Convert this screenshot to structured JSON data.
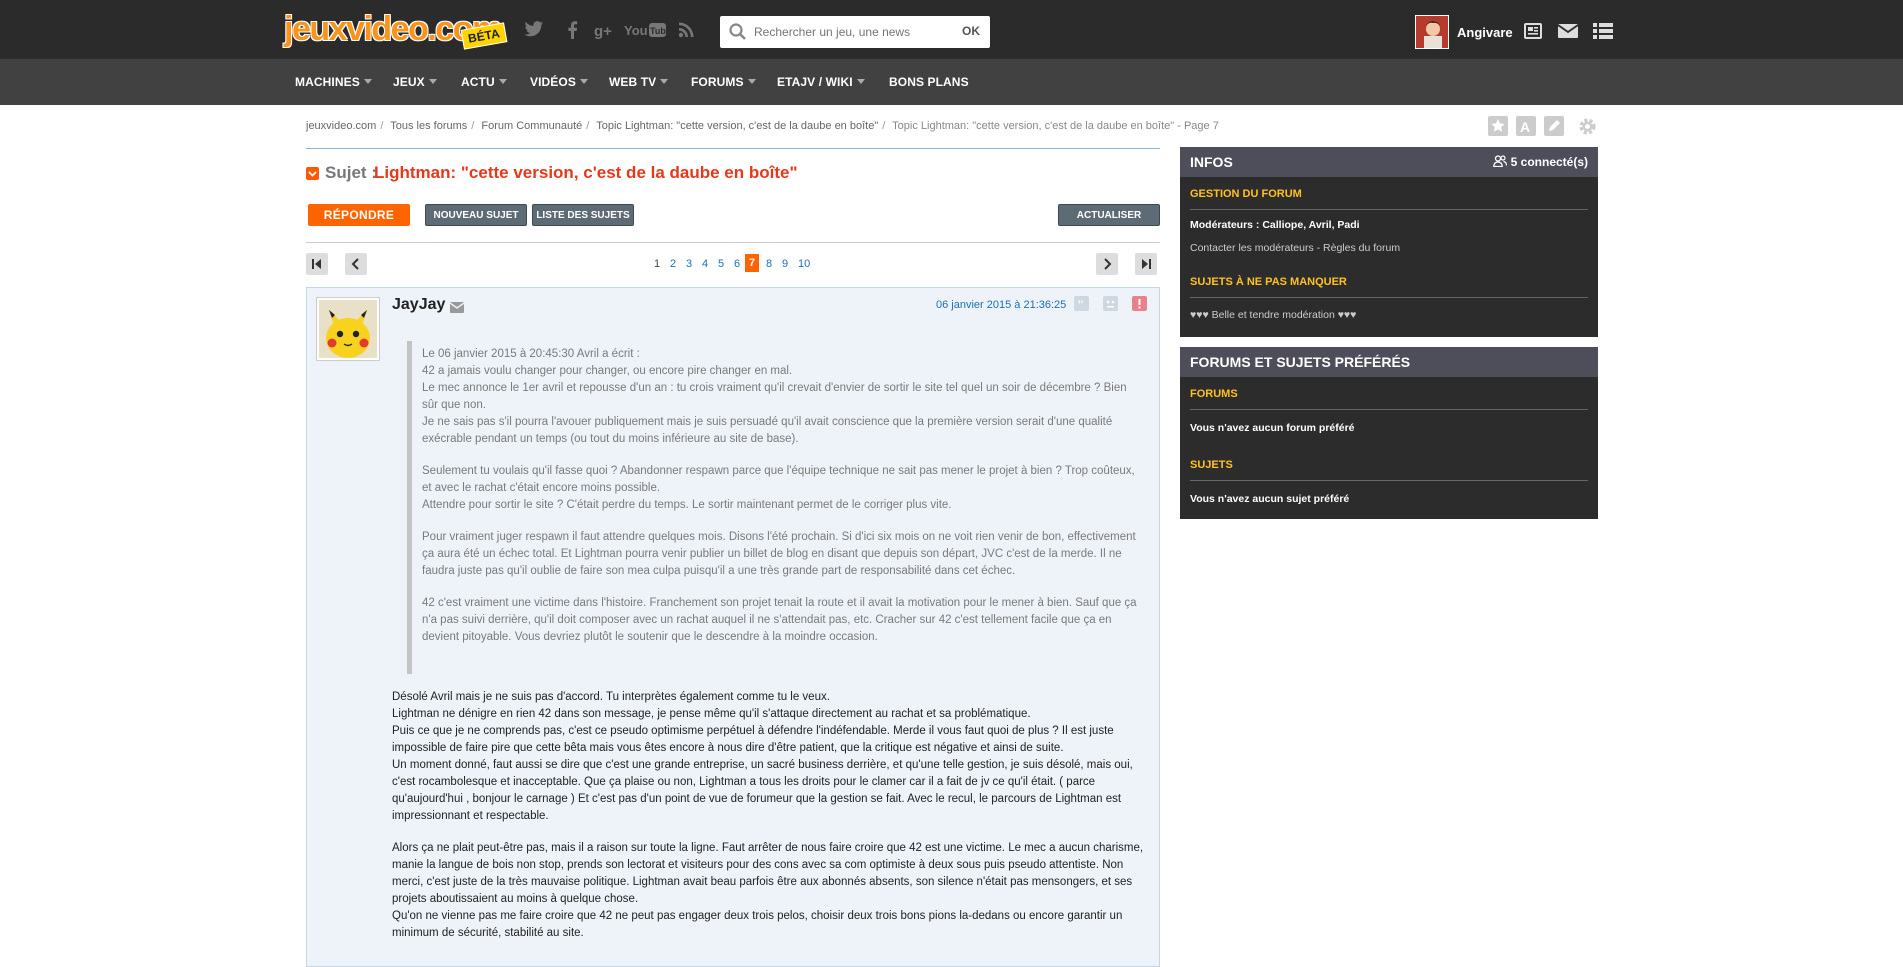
{
  "logo": {
    "text": "jeuxvideo.com",
    "badge": "BÉTA"
  },
  "search": {
    "placeholder": "Rechercher un jeu, une news",
    "ok": "OK"
  },
  "user": {
    "name": "Angivare"
  },
  "nav": [
    "MACHINES",
    "JEUX",
    "ACTU",
    "VIDÉOS",
    "WEB TV",
    "FORUMS",
    "ETAJV / WIKI",
    "BONS PLANS"
  ],
  "breadcrumb": [
    "jeuxvideo.com",
    "Tous les forums",
    "Forum Communauté",
    "Topic Lightman: \"cette version, c'est de la daube en boîte\"",
    "Topic Lightman: \"cette version, c'est de la daube en boîte\" - Page 7"
  ],
  "subject": {
    "label": "Sujet :",
    "title": "Lightman: \"cette version, c'est de la daube en boîte\""
  },
  "buttons": {
    "reply": "RÉPONDRE",
    "new_topic": "NOUVEAU SUJET",
    "topic_list": "LISTE DES SUJETS",
    "refresh": "ACTUALISER"
  },
  "pagination": {
    "pages": [
      "1",
      "2",
      "3",
      "4",
      "5",
      "6",
      "7",
      "8",
      "9",
      "10"
    ],
    "current": "7"
  },
  "post": {
    "author": "JayJay",
    "date": "06 janvier 2015 à 21:36:25",
    "quote": [
      "Le 06 janvier 2015 à 20:45:30 Avril a écrit :",
      "42 a jamais voulu changer pour changer, ou encore pire changer en mal.",
      "Le mec annonce le 1er avril et repousse d'un an : tu crois vraiment qu'il crevait d'envier de sortir le site tel quel un soir de décembre ? Bien sûr que non.",
      "Je ne sais pas s'il pourra l'avouer publiquement mais je suis persuadé qu'il avait conscience que la première version serait d'une qualité exécrable pendant un temps (ou tout du moins inférieure au site de base).",
      "Seulement tu voulais qu'il fasse quoi ? Abandonner respawn parce que l'équipe technique ne sait pas mener le projet à bien ? Trop coûteux, et avec le rachat c'était encore moins possible.",
      "Attendre pour sortir le site ? C'était perdre du temps. Le sortir maintenant permet de le corriger plus vite.",
      "Pour vraiment juger respawn il faut attendre quelques mois. Disons l'été prochain. Si d'ici six mois on ne voit rien venir de bon, effectivement ça aura été un échec total. Et Lightman pourra venir publier un billet de blog en disant que depuis son départ, JVC c'est de la merde. Il ne faudra juste pas qu'il oublie de faire son mea culpa puisqu'il a une très grande part de responsabilité dans cet échec.",
      "42 c'est vraiment une victime dans l'histoire. Franchement son projet tenait la route et il avait la motivation pour le mener à bien. Sauf que ça n'a pas suivi derrière, qu'il doit composer avec un rachat auquel il ne s'attendait pas, etc. Cracher sur 42 c'est tellement facile que ça en devient pitoyable. Vous devriez plutôt le soutenir que le descendre à la moindre occasion."
    ],
    "body": [
      "Désolé Avril mais je ne suis pas d'accord. Tu interprètes également comme tu le veux.",
      "Lightman ne dénigre en rien 42 dans son message, je pense même qu'il s'attaque directement au rachat et sa problématique.",
      "Puis ce que je ne comprends pas, c'est ce pseudo optimisme perpétuel à défendre l'indéfendable. Merde il vous faut quoi de plus ? Il est juste impossible de faire pire que cette bêta mais vous êtes encore à nous dire d'être patient, que la critique est négative et ainsi de suite.",
      "Un moment donné, faut aussi se dire que c'est une grande entreprise, un sacré business derrière, et qu'une telle gestion, je suis désolé, mais oui, c'est rocambolesque et inacceptable. Que ça plaise ou non, Lightman a tous les droits pour le clamer car il a fait de jv ce qu'il était. ( parce qu'aujourd'hui , bonjour le carnage ) Et c'est pas d'un point de vue de forumeur que la gestion se fait. Avec le recul, le parcours de Lightman est impressionnant et respectable.",
      "Alors ça ne plait peut-être pas, mais il a raison sur toute la ligne. Faut arrêter de nous faire croire que 42 est une victime. Le mec a aucun charisme, manie la langue de bois non stop, prends son lectorat et visiteurs pour des cons avec sa com optimiste à deux sous puis pseudo attentiste. Non merci, c'est juste de la très mauvaise politique. Lightman avait beau parfois être aux abonnés absents, son silence n'était pas mensongers, et ses projets aboutissaient au moins à quelque chose.",
      "Qu'on ne vienne pas me faire croire que 42 ne peut pas engager deux trois pelos, choisir deux trois bons pions la-dedans ou encore garantir un minimum de sécurité, stabilité au site."
    ]
  },
  "sidebar": {
    "infos": {
      "title": "INFOS",
      "connected": "5 connecté(s)",
      "gestion_title": "GESTION DU FORUM",
      "moderators": "Modérateurs : Calliope, Avril, Padi",
      "contact": "Contacter les modérateurs - Règles du forum",
      "must_see_title": "SUJETS À NE PAS MANQUER",
      "must_see_item": "♥♥♥ Belle et tendre modération ♥♥♥"
    },
    "favs": {
      "title": "FORUMS ET SUJETS PRÉFÉRÉS",
      "forums_title": "FORUMS",
      "forums_empty": "Vous n'avez aucun forum préféré",
      "topics_title": "SUJETS",
      "topics_empty": "Vous n'avez aucun sujet préféré"
    }
  },
  "colors": {
    "accent": "#ff6400",
    "header": "#2b2b2b",
    "nav": "#414141",
    "sidebar": "#2c2c2c",
    "sidebar_section": "#ffc21f",
    "link": "#1c6fb7"
  }
}
